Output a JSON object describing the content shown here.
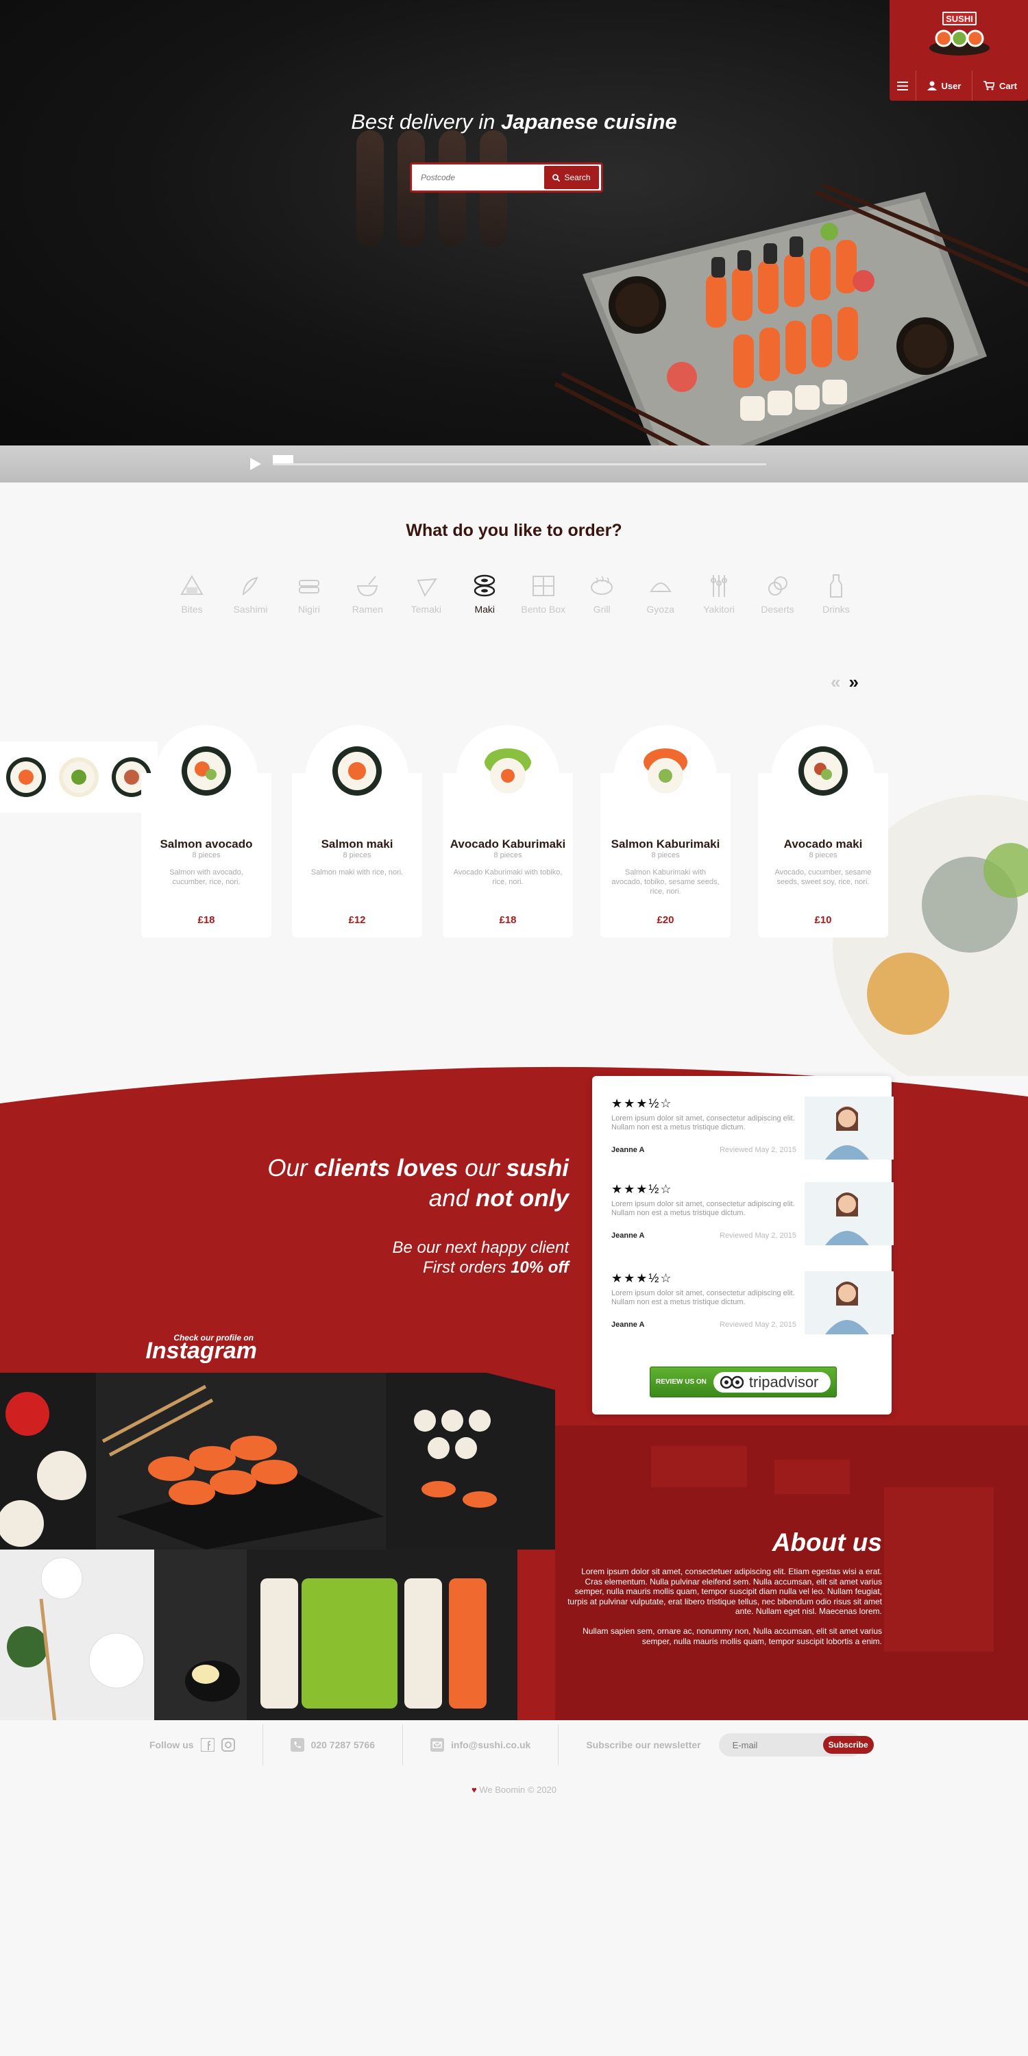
{
  "header": {
    "logo_text": "SUSHI",
    "menu_icon": "hamburger-icon",
    "user_label": "User",
    "cart_label": "Cart"
  },
  "hero": {
    "tagline_start": "Best delivery in",
    "tagline_bold": "Japanese cuisine",
    "search_placeholder": "Postcode",
    "search_label": "Search"
  },
  "order": {
    "title": "What do you like to order?",
    "categories": [
      {
        "label": "Bites",
        "icon": "onigiri-icon",
        "active": false
      },
      {
        "label": "Sashimi",
        "icon": "sashimi-icon",
        "active": false
      },
      {
        "label": "Nigiri",
        "icon": "nigiri-icon",
        "active": false
      },
      {
        "label": "Ramen",
        "icon": "ramen-bowl-icon",
        "active": false
      },
      {
        "label": "Temaki",
        "icon": "temaki-icon",
        "active": false
      },
      {
        "label": "Maki",
        "icon": "maki-icon",
        "active": true
      },
      {
        "label": "Bento Box",
        "icon": "bento-box-icon",
        "active": false
      },
      {
        "label": "Grill",
        "icon": "grill-icon",
        "active": false
      },
      {
        "label": "Gyoza",
        "icon": "gyoza-icon",
        "active": false
      },
      {
        "label": "Yakitori",
        "icon": "yakitori-icon",
        "active": false
      },
      {
        "label": "Deserts",
        "icon": "mochi-icon",
        "active": false
      },
      {
        "label": "Drinks",
        "icon": "drink-bottle-icon",
        "active": false
      }
    ],
    "prev_arrow": "«",
    "next_arrow": "»"
  },
  "products": [
    {
      "name": "Salmon avocado",
      "pieces": "8 pieces",
      "desc": "Salmon with avocado, cucumber, rice, nori.",
      "price": "£18"
    },
    {
      "name": "Salmon maki",
      "pieces": "8 pieces",
      "desc": "Salmon maki with rice, nori.",
      "price": "£12"
    },
    {
      "name": "Avocado Kaburimaki",
      "pieces": "8 pieces",
      "desc": "Avocado Kaburimaki with tobiko, rice, nori.",
      "price": "£18"
    },
    {
      "name": "Salmon Kaburimaki",
      "pieces": "8 pieces",
      "desc": "Salmon Kaburimaki with avocado, tobiko, sesame seeds, rice, nori.",
      "price": "£20"
    },
    {
      "name": "Avocado maki",
      "pieces": "8 pieces",
      "desc": "Avocado, cucumber, sesame seeds, sweet soy, rice, nori.",
      "price": "£10"
    }
  ],
  "testimonials": {
    "headline_1": "Our",
    "headline_2": "clients loves",
    "headline_3": "our",
    "headline_4": "sushi",
    "headline_5": "and",
    "headline_6": "not only",
    "sub_1": "Be our next happy client",
    "sub_2": "First orders",
    "sub_3": "10% off",
    "reviews": [
      {
        "stars": "★★★½☆",
        "text": "Lorem ipsum dolor sit amet, consectetur adipiscing elit. Nullam non est a metus tristique dictum.",
        "author": "Jeanne A",
        "date": "Reviewed May 2, 2015"
      },
      {
        "stars": "★★★½☆",
        "text": "Lorem ipsum dolor sit amet, consectetur adipiscing elit. Nullam non est a metus tristique dictum.",
        "author": "Jeanne A",
        "date": "Reviewed May 2, 2015"
      },
      {
        "stars": "★★★½☆",
        "text": "Lorem ipsum dolor sit amet, consectetur adipiscing elit. Nullam non est a metus tristique dictum.",
        "author": "Jeanne A",
        "date": "Reviewed May 2, 2015"
      }
    ],
    "tripadvisor_review": "REVIEW US ON",
    "tripadvisor_logo": "tripadvisor"
  },
  "instagram": {
    "small": "Check our profile on",
    "big": "Instagram"
  },
  "about": {
    "title": "About us",
    "p1": "Lorem ipsum dolor sit amet, consectetuer adipiscing elit. Etiam egestas wisi a erat. Cras elementum. Nulla pulvinar eleifend sem. Nulla accumsan, elit sit amet varius semper, nulla mauris mollis quam, tempor suscipit diam nulla vel leo. Nullam feugiat, turpis at pulvinar vulputate, erat libero tristique tellus, nec bibendum odio risus sit amet ante. Nullam eget nisl. Maecenas lorem.",
    "p2": "Nullam sapien sem, ornare ac, nonummy non, Nulla accumsan, elit sit amet varius semper, nulla mauris mollis quam, tempor suscipit lobortis a enim."
  },
  "footer": {
    "follow": "Follow us",
    "phone": "020 7287 5766",
    "email": "info@sushi.co.uk",
    "newsletter": "Subscribe our newsletter",
    "email_placeholder": "E-mail",
    "subscribe": "Subscribe",
    "copyright": "We Boomin © 2020"
  }
}
